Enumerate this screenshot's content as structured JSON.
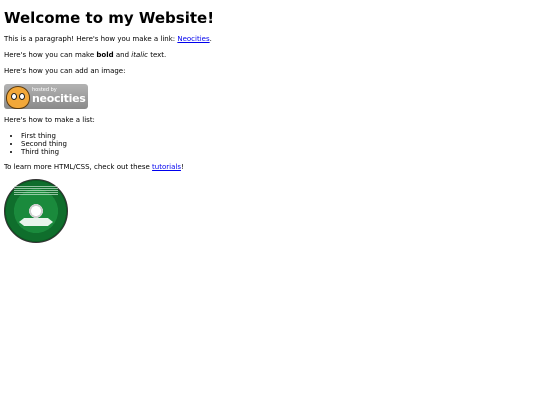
{
  "heading": "Welcome to my Website!",
  "para1": {
    "text_before": "This is a paragraph! Here's how you make a link: ",
    "link": "Neocities",
    "text_after": "."
  },
  "para2": {
    "text_before": "Here's how you can make ",
    "bold": "bold",
    "text_middle": " and ",
    "italic": "italic",
    "text_after": " text."
  },
  "para3": "Here's how you can add an image:",
  "badge": {
    "small_text": "hosted by",
    "brand_text": "neocities"
  },
  "para4": "Here's how to make a list:",
  "list": [
    "First thing",
    "Second thing",
    "Third thing"
  ],
  "para5": {
    "text_before": "To learn more HTML/CSS, check out these ",
    "link": "tutorials",
    "text_after": "!"
  }
}
